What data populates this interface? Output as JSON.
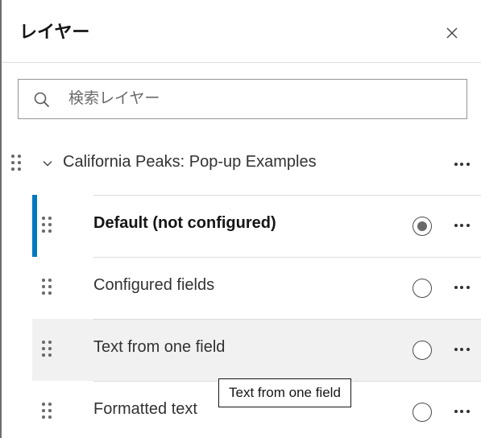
{
  "header": {
    "title": "レイヤー",
    "close_icon": "close-icon"
  },
  "search": {
    "placeholder": "検索レイヤー",
    "value": "",
    "icon": "search-icon"
  },
  "group": {
    "label": "California Peaks: Pop-up Examples",
    "expanded": true
  },
  "layers": [
    {
      "label": "Default (not configured)",
      "selected": true
    },
    {
      "label": "Configured fields",
      "selected": false
    },
    {
      "label": "Text from one field",
      "selected": false,
      "hovered": true
    },
    {
      "label": "Formatted text",
      "selected": false
    }
  ],
  "tooltip": {
    "text": "Text from one field"
  },
  "colors": {
    "accent": "#0079c1",
    "hover_background": "#f1f1f1",
    "divider": "#dcdcdc"
  }
}
